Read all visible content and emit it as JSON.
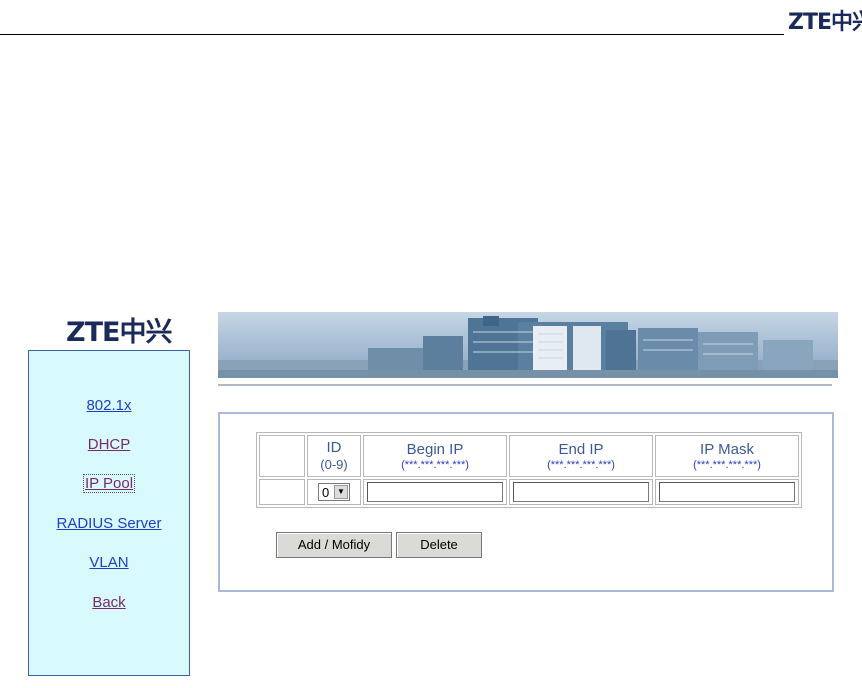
{
  "brand": {
    "logo_text": "ZTE中兴"
  },
  "sidebar": {
    "items": [
      {
        "label": "802.1x"
      },
      {
        "label": "DHCP"
      },
      {
        "label": "IP Pool"
      },
      {
        "label": "RADIUS Server"
      },
      {
        "label": "VLAN"
      },
      {
        "label": "Back"
      }
    ]
  },
  "table": {
    "headers": [
      {
        "title": "",
        "sub": ""
      },
      {
        "title": "ID",
        "sub": "(0-9)"
      },
      {
        "title": "Begin IP",
        "sub": "(***.***.***.***)"
      },
      {
        "title": "End IP",
        "sub": "(***.***.***.***)"
      },
      {
        "title": "IP Mask",
        "sub": "(***.***.***.***)"
      }
    ],
    "id_select_value": "0",
    "begin_ip_value": "",
    "end_ip_value": "",
    "ip_mask_value": ""
  },
  "buttons": {
    "add_label": "Add / Mofidy",
    "delete_label": "Delete"
  },
  "colors": {
    "sidebar_bg": "#d9fafc",
    "link_blue": "#1e3fc0",
    "link_visited": "#7a2a6a",
    "panel_border": "#a9b9d6"
  }
}
